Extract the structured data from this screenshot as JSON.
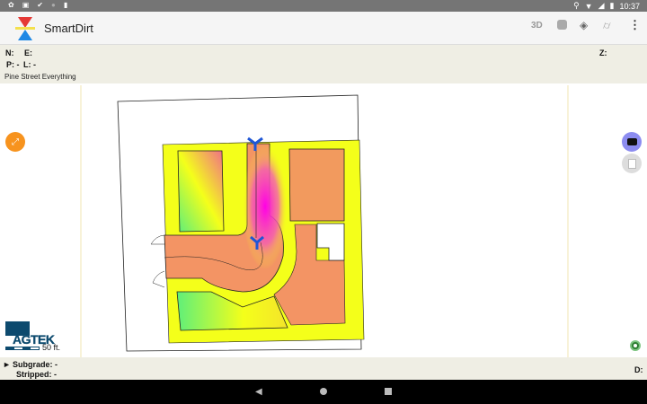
{
  "status_bar": {
    "time": "10:37",
    "left_icons": [
      "settings-icon",
      "notification-icon",
      "check-icon",
      "circle-icon",
      "sd-card-icon"
    ],
    "right_icons": [
      "location-icon",
      "wifi-icon",
      "signal-icon",
      "battery-icon"
    ]
  },
  "app_bar": {
    "title": "SmartDirt",
    "actions": [
      "3d-icon",
      "camera-view-icon",
      "layers-icon",
      "roll-plans-icon",
      "more-vert-icon"
    ],
    "label_3d": "3D"
  },
  "coords": {
    "n": "N:",
    "e": "E:",
    "z": "Z:",
    "p": "P: -",
    "l": "L: -"
  },
  "project_name": "Pine Street Everything",
  "scale": {
    "logo": "AGTEK",
    "label": "50 ft."
  },
  "bottom": {
    "subgrade": "Subgrade: -",
    "stripped": "Stripped: -",
    "d": "D:"
  },
  "colors": {
    "accent_fab": "#f7931e",
    "camera_fab": "#8c8cf0",
    "gps": "#2e7d32"
  }
}
